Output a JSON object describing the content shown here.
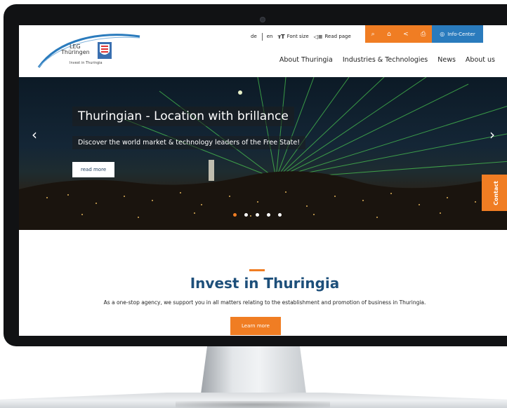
{
  "logo": {
    "line1": "LEG",
    "line2": "Thüringen",
    "tagline": "Invest in Thuringia"
  },
  "toolbar": {
    "lang_de": "de",
    "lang_en": "en",
    "font_size": "Font size",
    "read_page": "Read page",
    "info_center": "Info-Center"
  },
  "nav": {
    "items": [
      "About Thuringia",
      "Industries & Technologies",
      "News",
      "About us"
    ]
  },
  "hero": {
    "title": "Thuringian - Location with brillance",
    "subtitle": "Discover the world market & technology leaders of the Free State!",
    "button": "read more",
    "slides_total": 5,
    "active_slide": 1
  },
  "contact": {
    "label": "Contact"
  },
  "invest": {
    "title": "Invest in Thuringia",
    "text": "As a one-stop agency, we support you in all matters relating to the establishment and promotion of business in Thuringia.",
    "button": "Learn more"
  },
  "colors": {
    "accent": "#f07d23",
    "brand_blue": "#1d4f7a",
    "info_blue": "#2a7bbd"
  },
  "icons": [
    "text-size-icon",
    "read-page-icon",
    "search-icon",
    "lock-icon",
    "share-icon",
    "print-icon",
    "compass-icon",
    "chevron-left-icon",
    "chevron-right-icon"
  ]
}
